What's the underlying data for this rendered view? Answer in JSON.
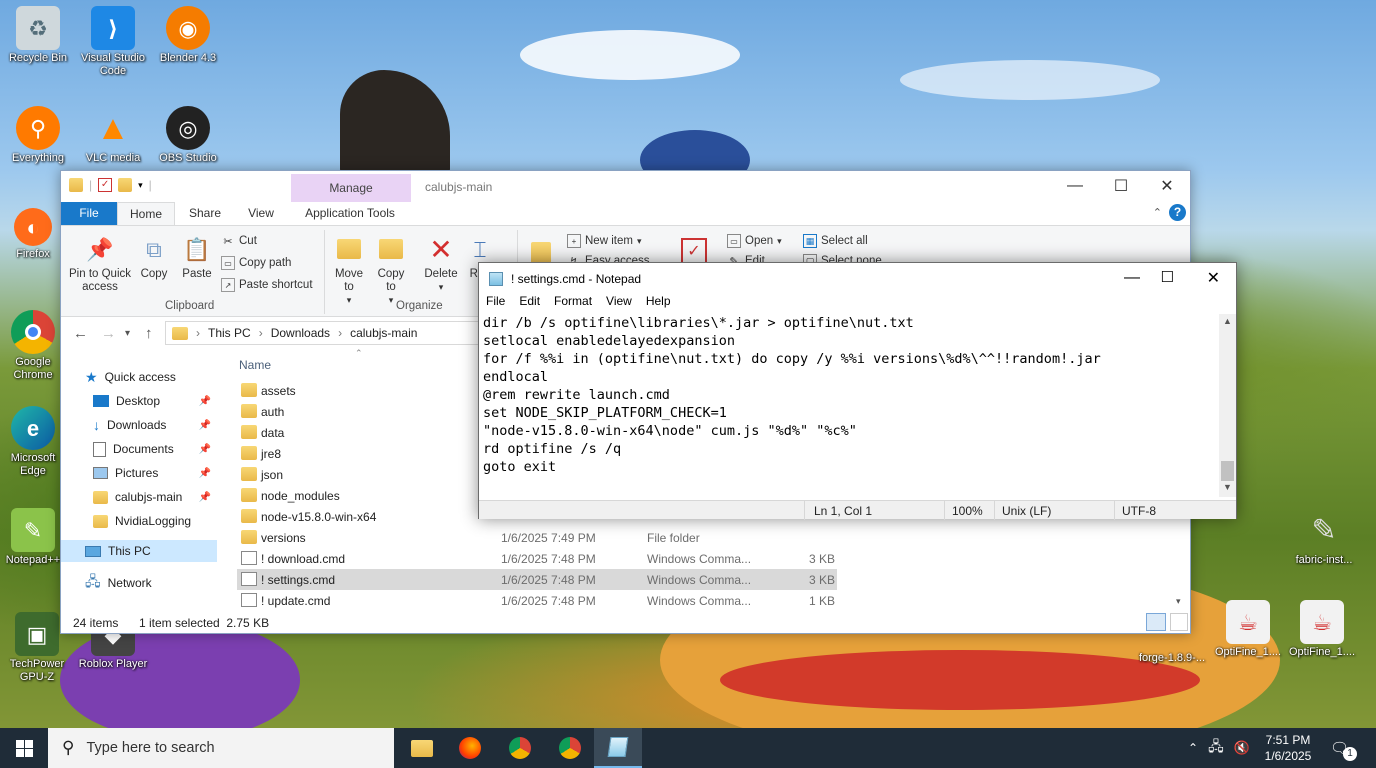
{
  "desktop": {
    "icons": [
      {
        "label": "Recycle Bin"
      },
      {
        "label": "Visual Studio Code"
      },
      {
        "label": "Blender 4.3"
      },
      {
        "label": "Everything"
      },
      {
        "label": "VLC media"
      },
      {
        "label": "OBS Studio"
      },
      {
        "label": "Firefox"
      },
      {
        "label": "Google Chrome"
      },
      {
        "label": "Microsoft Edge"
      },
      {
        "label": "Notepad++"
      },
      {
        "label": "TechPower GPU-Z"
      },
      {
        "label": "Roblox Player"
      },
      {
        "label": "fabric-inst..."
      },
      {
        "label": "forge-1.8.9-..."
      },
      {
        "label": "OptiFine_1...."
      },
      {
        "label": "OptiFine_1...."
      }
    ]
  },
  "explorer": {
    "title": "calubjs-main",
    "manage_tab": "Manage",
    "tabs": {
      "file": "File",
      "home": "Home",
      "share": "Share",
      "view": "View",
      "app_tools": "Application Tools"
    },
    "ribbon": {
      "pin": "Pin to Quick access",
      "copy": "Copy",
      "paste": "Paste",
      "cut": "Cut",
      "copy_path": "Copy path",
      "paste_shortcut": "Paste shortcut",
      "clipboard": "Clipboard",
      "move_to": "Move to",
      "copy_to": "Copy to",
      "delete": "Delete",
      "rename": "Re",
      "organize": "Organize",
      "new_item": "New item",
      "easy_access": "Easy access",
      "open": "Open",
      "edit": "Edit",
      "select_all": "Select all",
      "select_none": "Select none"
    },
    "breadcrumb": [
      "This PC",
      "Downloads",
      "calubjs-main"
    ],
    "nav": {
      "quick_access": "Quick access",
      "items": [
        {
          "label": "Desktop"
        },
        {
          "label": "Downloads"
        },
        {
          "label": "Documents"
        },
        {
          "label": "Pictures"
        },
        {
          "label": "calubjs-main"
        },
        {
          "label": "NvidiaLogging"
        }
      ],
      "this_pc": "This PC",
      "network": "Network"
    },
    "columns": {
      "name": "Name"
    },
    "files": [
      {
        "name": "assets",
        "date": "",
        "type": "",
        "size": ""
      },
      {
        "name": "auth",
        "date": "",
        "type": "",
        "size": ""
      },
      {
        "name": "data",
        "date": "",
        "type": "",
        "size": ""
      },
      {
        "name": "jre8",
        "date": "",
        "type": "",
        "size": ""
      },
      {
        "name": "json",
        "date": "",
        "type": "",
        "size": ""
      },
      {
        "name": "node_modules",
        "date": "",
        "type": "",
        "size": ""
      },
      {
        "name": "node-v15.8.0-win-x64",
        "date": "",
        "type": "",
        "size": ""
      },
      {
        "name": "versions",
        "date": "1/6/2025 7:49 PM",
        "type": "File folder",
        "size": ""
      },
      {
        "name": "! download.cmd",
        "date": "1/6/2025 7:48 PM",
        "type": "Windows Comma...",
        "size": "3 KB"
      },
      {
        "name": "! settings.cmd",
        "date": "1/6/2025 7:48 PM",
        "type": "Windows Comma...",
        "size": "3 KB"
      },
      {
        "name": "! update.cmd",
        "date": "1/6/2025 7:48 PM",
        "type": "Windows Comma...",
        "size": "1 KB"
      }
    ],
    "status": {
      "items": "24 items",
      "selected": "1 item selected  2.75 KB"
    }
  },
  "notepad": {
    "title": "! settings.cmd - Notepad",
    "menu": [
      "File",
      "Edit",
      "Format",
      "View",
      "Help"
    ],
    "lines": [
      "dir /b /s optifine\\libraries\\*.jar > optifine\\nut.txt",
      "setlocal enabledelayedexpansion",
      "for /f %%i in (optifine\\nut.txt) do copy /y %%i versions\\%d%\\^^!!random!.jar",
      "endlocal",
      "@rem rewrite launch.cmd",
      "set NODE_SKIP_PLATFORM_CHECK=1",
      "\"node-v15.8.0-win-x64\\node\" cum.js \"%d%\" \"%c%\"",
      "rd optifine /s /q",
      "goto exit"
    ],
    "status": {
      "position": "Ln 1, Col 1",
      "zoom": "100%",
      "eol": "Unix (LF)",
      "encoding": "UTF-8"
    }
  },
  "taskbar": {
    "search_placeholder": "Type here to search",
    "time": "7:51 PM",
    "date": "1/6/2025",
    "notification_count": "1"
  },
  "colors": {
    "accent": "#1979ca",
    "taskbar": "#1f2c38",
    "manage": "#e9d3f5"
  }
}
